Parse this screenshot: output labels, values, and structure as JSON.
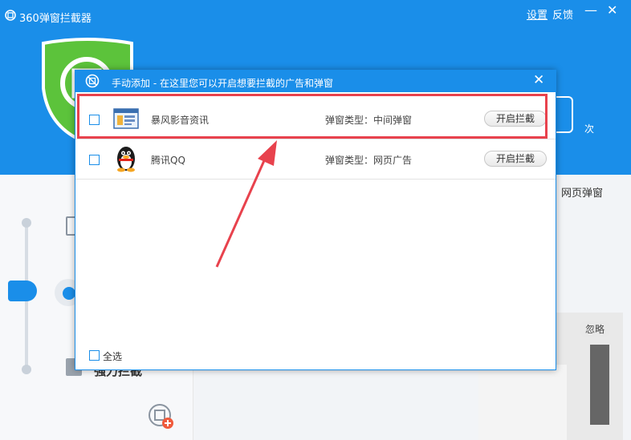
{
  "app": {
    "title": "360弹窗拦截器",
    "settings_label": "设置",
    "feedback_label": "反馈",
    "minimize_glyph": "—",
    "close_glyph": "✕",
    "count_unit": "次",
    "tab_web_popup": "网页弹窗",
    "strong_block_label": "强力拦截",
    "ignore_label": "忽略"
  },
  "dialog": {
    "title": "手动添加 - 在这里您可以开启想要拦截的广告和弹窗",
    "close_glyph": "✕",
    "rows": [
      {
        "name": "暴风影音资讯",
        "type": "弹窗类型：中间弹窗",
        "button": "开启拦截",
        "icon": "storm-player-icon"
      },
      {
        "name": "腾讯QQ",
        "type": "弹窗类型：网页广告",
        "button": "开启拦截",
        "icon": "qq-penguin-icon"
      }
    ],
    "select_all_label": "全选"
  },
  "colors": {
    "brand_blue": "#1a8ee9",
    "highlight_red": "#e8424d",
    "shield_green": "#5cc33b"
  }
}
